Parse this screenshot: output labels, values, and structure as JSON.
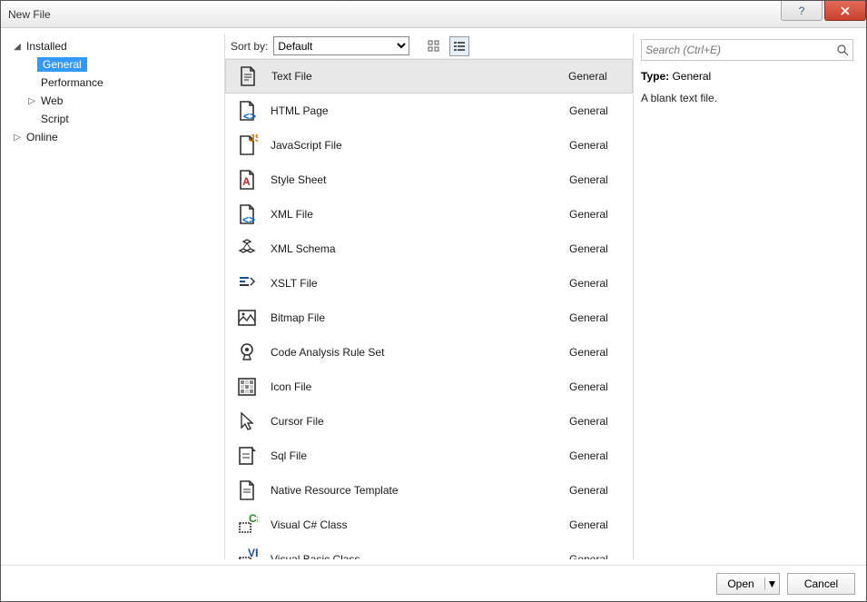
{
  "window": {
    "title": "New File"
  },
  "sidebar": {
    "installed": {
      "label": "Installed",
      "items": [
        {
          "label": "General",
          "selected": true
        },
        {
          "label": "Performance"
        },
        {
          "label": "Web",
          "has_children": true
        },
        {
          "label": "Script"
        }
      ]
    },
    "online": {
      "label": "Online"
    }
  },
  "toolbar": {
    "sort_label": "Sort by:",
    "sort_value": "Default"
  },
  "templates": [
    {
      "name": "Text File",
      "category": "General",
      "icon": "text-file-icon",
      "selected": true
    },
    {
      "name": "HTML Page",
      "category": "General",
      "icon": "html-page-icon"
    },
    {
      "name": "JavaScript File",
      "category": "General",
      "icon": "javascript-file-icon"
    },
    {
      "name": "Style Sheet",
      "category": "General",
      "icon": "style-sheet-icon"
    },
    {
      "name": "XML File",
      "category": "General",
      "icon": "xml-file-icon"
    },
    {
      "name": "XML Schema",
      "category": "General",
      "icon": "xml-schema-icon"
    },
    {
      "name": "XSLT File",
      "category": "General",
      "icon": "xslt-file-icon"
    },
    {
      "name": "Bitmap File",
      "category": "General",
      "icon": "bitmap-file-icon"
    },
    {
      "name": "Code Analysis Rule Set",
      "category": "General",
      "icon": "code-analysis-rule-set-icon"
    },
    {
      "name": "Icon File",
      "category": "General",
      "icon": "icon-file-icon"
    },
    {
      "name": "Cursor File",
      "category": "General",
      "icon": "cursor-file-icon"
    },
    {
      "name": "Sql File",
      "category": "General",
      "icon": "sql-file-icon"
    },
    {
      "name": "Native Resource Template",
      "category": "General",
      "icon": "native-resource-template-icon"
    },
    {
      "name": "Visual C# Class",
      "category": "General",
      "icon": "visual-csharp-class-icon"
    },
    {
      "name": "Visual Basic Class",
      "category": "General",
      "icon": "visual-basic-class-icon"
    }
  ],
  "search": {
    "placeholder": "Search (Ctrl+E)"
  },
  "details": {
    "type_label": "Type:",
    "type_value": "General",
    "description": "A blank text file."
  },
  "footer": {
    "open_label": "Open",
    "cancel_label": "Cancel"
  }
}
